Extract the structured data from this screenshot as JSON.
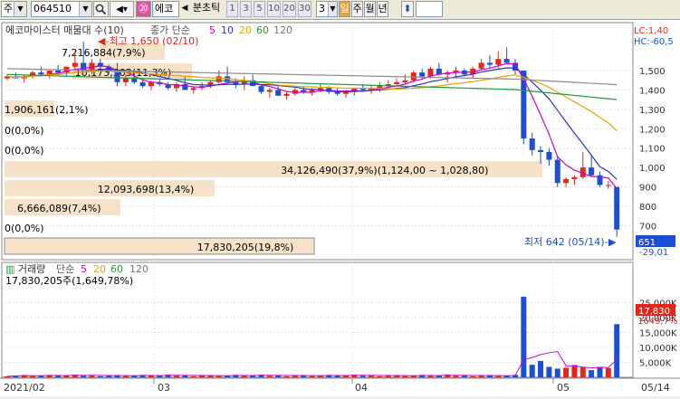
{
  "toolbar": {
    "market": "주",
    "code": "064510",
    "name_short": "에코",
    "period_label": "분초틱",
    "periods": [
      "1",
      "3",
      "5",
      "10",
      "20",
      "30"
    ],
    "period_count": "3",
    "day": "일",
    "week": "주",
    "month": "월",
    "year": "년"
  },
  "chart": {
    "title": "에코마이스터 매물대 수(10)",
    "price_label": "종가 단순",
    "ma_periods": [
      "5",
      "10",
      "20",
      "60",
      "120"
    ],
    "lc": "LC:1,40",
    "hc": "HC:-60,5",
    "high_marker": "최고 1,650 (02/10)",
    "low_marker": "최저 642 (05/14)",
    "current_price": "651",
    "current_change": "-29,01",
    "y_ticks": [
      "1,500",
      "1,400",
      "1,300",
      "1,200",
      "1,100",
      "1,000",
      "900",
      "800",
      "700"
    ],
    "volume_profile": [
      "7,216,884(7,9%)",
      "10,173,303(11,3%)",
      "1,906,161(2,1%)",
      "0(0,0%)",
      "0(0,0%)",
      "34,126,490(37,9%)(1,124,00 ~ 1,028,80)",
      "12,093,698(13,4%)",
      "6,666,089(7,4%)",
      "0(0,0%)",
      "17,830,205(19,8%)"
    ]
  },
  "volume": {
    "title": "거래량",
    "ma_label": "단순",
    "ma_periods": [
      "5",
      "20",
      "60",
      "120"
    ],
    "current": "17,830,205주(1,649,78%)",
    "y_ticks": [
      "25,000K",
      "20,000K",
      "15,000K",
      "10,000K",
      "5,000K"
    ],
    "current_tag": "17,830",
    "pct_tag": "1649,7%"
  },
  "xaxis": [
    "2021/02",
    "03",
    "04",
    "05",
    "05/14"
  ],
  "colors": {
    "up": "#e8251b",
    "down": "#1c4fd6",
    "ma5": "#d000d0",
    "ma10": "#2a35c8",
    "ma20": "#f0a000",
    "ma60": "#1f9a3a",
    "ma120": "#8a8a8a",
    "band": "#f5dcc0"
  }
}
